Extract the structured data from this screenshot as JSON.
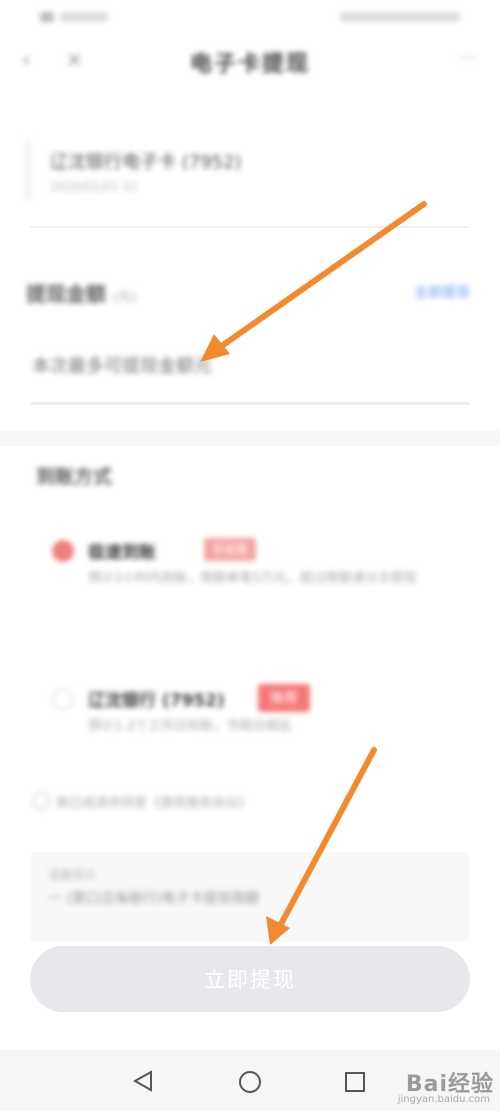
{
  "nav": {
    "title": "电子卡提现"
  },
  "card": {
    "title": "辽沈银行电子卡 (7952)",
    "subtitle": "2020/01/01 01"
  },
  "amount": {
    "label": "提现金额",
    "unit": "(元)",
    "link": "全部提现",
    "placeholder": "本次最多可提现金额元"
  },
  "method": {
    "label": "到账方式",
    "options": [
      {
        "title": "极速到账",
        "badge": "手续费",
        "desc": "预计2小时内到账，限额单笔5万元，超过限额请分次提现"
      },
      {
        "title": "辽沈银行 (7952)",
        "badge": "推荐",
        "desc": "预计1-2个工作日到账，节假日顺延"
      }
    ]
  },
  "agreement": {
    "text": "我已阅读并同意《提现服务协议》"
  },
  "notice": {
    "title": "温馨提示",
    "text": "一 (营口沿海银行)电子卡提现限额"
  },
  "submit": {
    "label": "立即提现"
  },
  "watermark": {
    "text": "Bai经验",
    "paw": "🐾",
    "sub": "jingyan.baidu.com"
  },
  "colors": {
    "arrow": "#f28a30",
    "accent_red": "#f37878",
    "link_blue": "#6e9cf2",
    "button_bg": "#e7e8ec"
  }
}
